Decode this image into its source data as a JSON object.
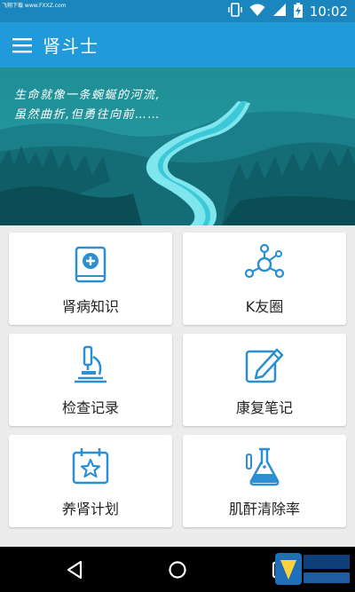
{
  "statusbar": {
    "corner_text": "飞翔下载 www.FXXZ.com",
    "time": "10:02"
  },
  "appbar": {
    "title": "肾斗士"
  },
  "banner": {
    "line1": "生命就像一条蜿蜒的河流,",
    "line2": "虽然曲折,但勇往向前……"
  },
  "tiles": [
    {
      "label": "肾病知识",
      "icon": "book-plus-icon"
    },
    {
      "label": "K友圈",
      "icon": "network-icon"
    },
    {
      "label": "检查记录",
      "icon": "microscope-icon"
    },
    {
      "label": "康复笔记",
      "icon": "pencil-note-icon"
    },
    {
      "label": "养肾计划",
      "icon": "calendar-star-icon"
    },
    {
      "label": "肌酐清除率",
      "icon": "flask-icon"
    }
  ],
  "colors": {
    "accent": "#209ad8",
    "statusbar": "#1b86bd",
    "icon": "#2b8fd1"
  }
}
